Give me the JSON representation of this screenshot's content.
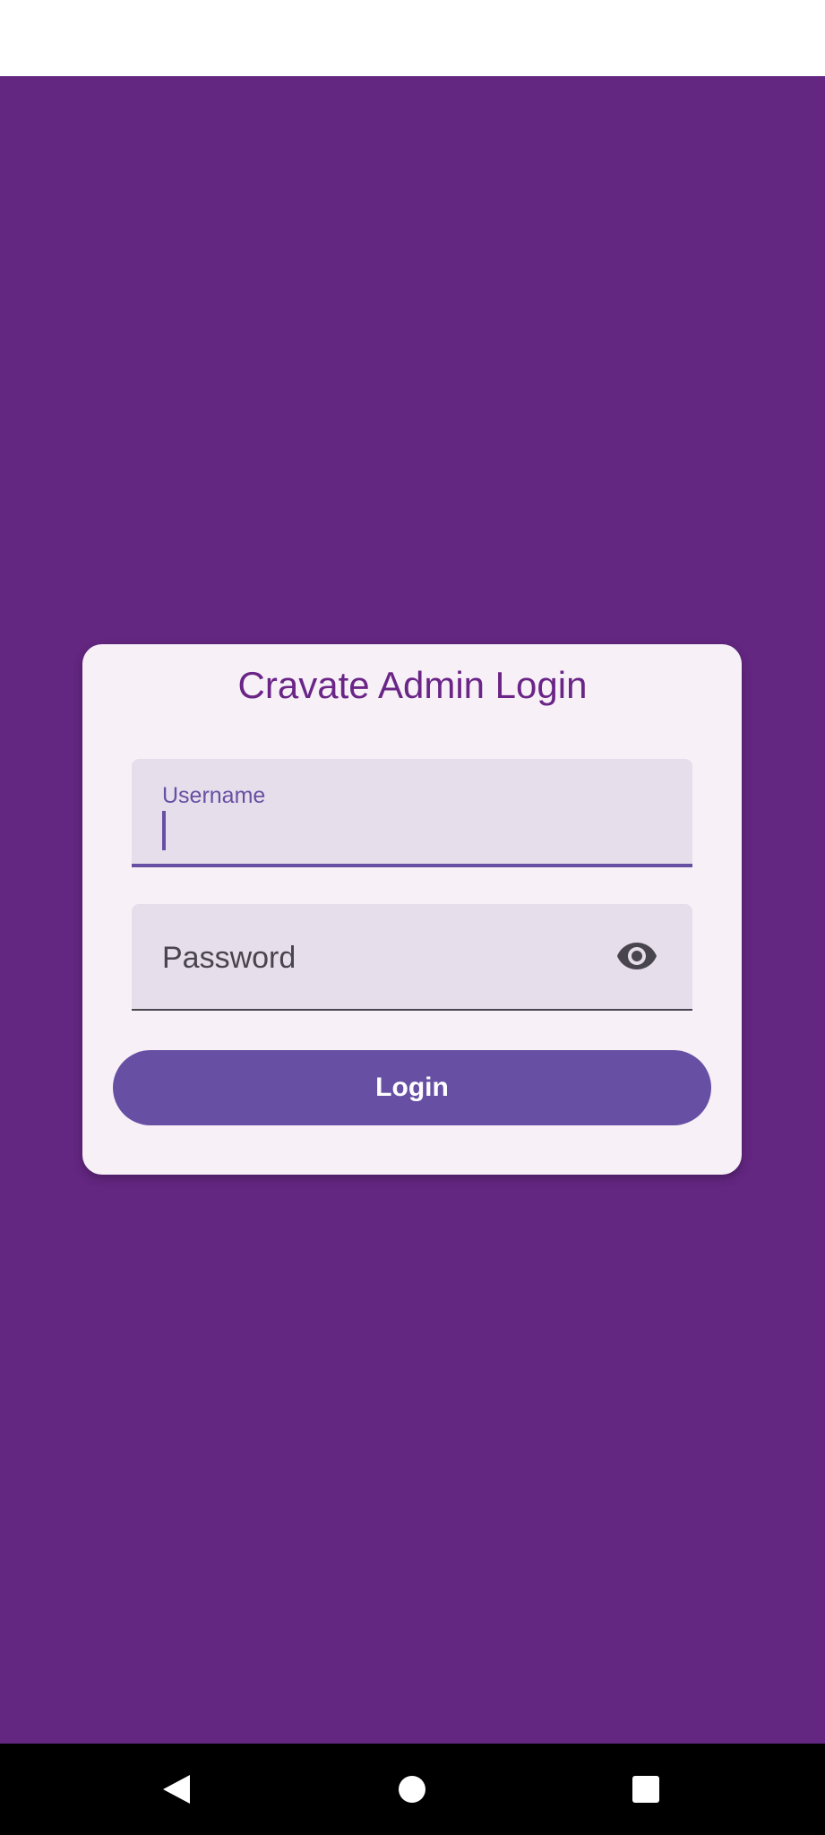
{
  "app": {
    "login_title": "Cravate Admin Login"
  },
  "form": {
    "username_label": "Username",
    "username_value": "",
    "password_label": "Password",
    "password_value": "",
    "password_toggle_icon": "eye-icon",
    "login_label": "Login"
  },
  "navigation": {
    "back_icon": "back-triangle-icon",
    "home_icon": "home-circle-icon",
    "recents_icon": "recents-square-icon"
  },
  "colors": {
    "background": "#632681",
    "card": "#f7f1f7",
    "field": "#e6deea",
    "accent": "#6750a4",
    "title": "#6a2587",
    "system_bar": "#000000"
  }
}
